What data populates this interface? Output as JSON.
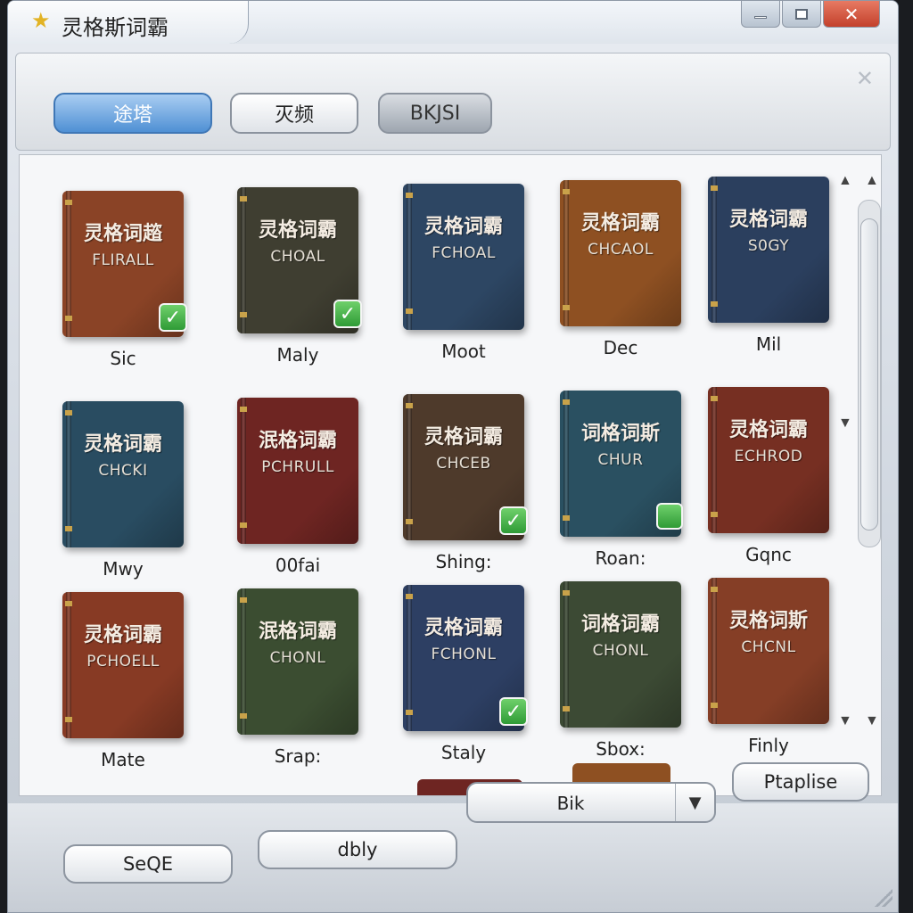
{
  "window": {
    "title": "灵格斯词霸",
    "title_icon": "star-icon",
    "controls": {
      "minimize": "minimize-icon",
      "maximize": "maximize-icon",
      "close": "✕"
    }
  },
  "toolbar": {
    "buttons": [
      {
        "label": "途塔",
        "active": true
      },
      {
        "label": "灭频",
        "active": false
      },
      {
        "label": "BKJSI",
        "active": false
      }
    ],
    "panel_close": "✕"
  },
  "books": [
    {
      "title": "灵格词趦",
      "subtitle": "FLIRALL",
      "label": "Sic",
      "color": "#8a4326",
      "checked": true
    },
    {
      "title": "灵格词霸",
      "subtitle": "CHOAL",
      "label": "Maly",
      "color": "#3f3e31",
      "checked": true
    },
    {
      "title": "灵格词霸",
      "subtitle": "FCHOAL",
      "label": "Moot",
      "color": "#2d4663",
      "checked": false
    },
    {
      "title": "灵格词霸",
      "subtitle": "CHCAOL",
      "label": "Dec",
      "color": "#8e5022",
      "checked": false
    },
    {
      "title": "灵格词霸",
      "subtitle": "S0GY",
      "label": "Mil",
      "color": "#2b3f5e",
      "checked": false
    },
    {
      "title": "灵格词霸",
      "subtitle": "CHCKI",
      "label": "Mwy",
      "color": "#294c61",
      "checked": false
    },
    {
      "title": "泯格词霸",
      "subtitle": "PCHRULL",
      "label": "00fai",
      "color": "#6e2522",
      "checked": false
    },
    {
      "title": "灵格词霸",
      "subtitle": "CHCEB",
      "label": "Shing:",
      "color": "#4e3a2b",
      "checked": true
    },
    {
      "title": "词格词斯",
      "subtitle": "CHUR",
      "label": "Roan:",
      "color": "#2a5061",
      "checked": false,
      "badge_only": true
    },
    {
      "title": "灵格词霸",
      "subtitle": "ECHROD",
      "label": "Gqnc",
      "color": "#762f22",
      "checked": false
    },
    {
      "title": "灵格词霸",
      "subtitle": "PCHOELL",
      "label": "Mate",
      "color": "#873a24",
      "checked": false
    },
    {
      "title": "泯格词霸",
      "subtitle": "CHONL",
      "label": "Srap:",
      "color": "#3b4d31",
      "checked": false
    },
    {
      "title": "灵格词霸",
      "subtitle": "FCHONL",
      "label": "Staly",
      "color": "#2d3f63",
      "checked": true
    },
    {
      "title": "词格词霸",
      "subtitle": "CHONL",
      "label": "Sbox:",
      "color": "#3c4a34",
      "checked": false
    },
    {
      "title": "灵格词斯",
      "subtitle": "CHCNL",
      "label": "Finly",
      "color": "#853e26",
      "checked": false
    }
  ],
  "bottom": {
    "button_left": "SeQE",
    "button_mid": "dbly",
    "dropdown_value": "Bik",
    "dropdown_arrow": "▼",
    "button_right": "Ptaplise"
  },
  "scroll": {
    "up": "▲",
    "down": "▼"
  }
}
